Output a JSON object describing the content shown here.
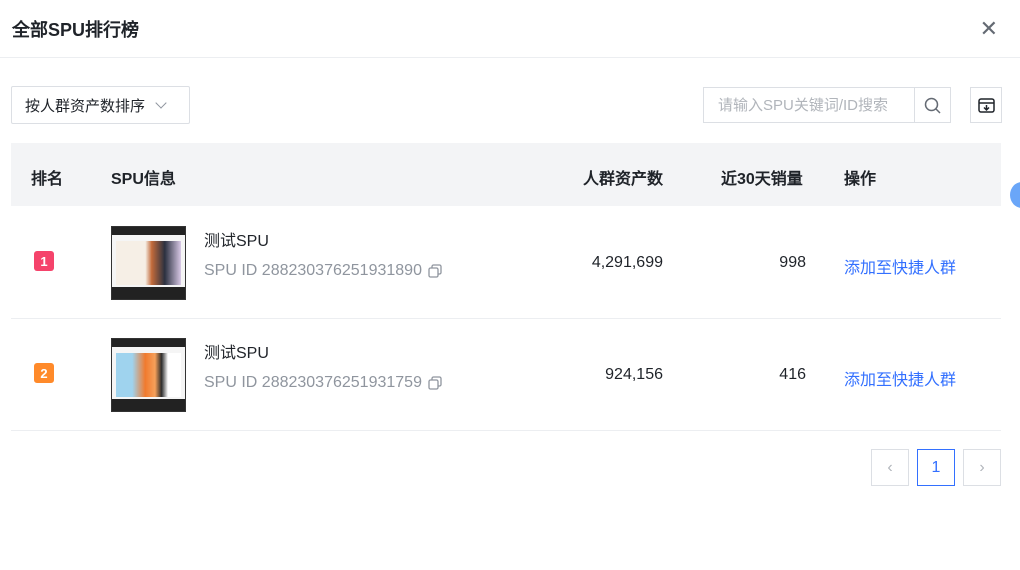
{
  "dialog": {
    "title": "全部SPU排行榜"
  },
  "toolbar": {
    "sort_label": "按人群资产数排序",
    "search_placeholder": "请输入SPU关键词/ID搜索",
    "search_value": ""
  },
  "table": {
    "headers": {
      "rank": "排名",
      "spu": "SPU信息",
      "assets": "人群资产数",
      "sales": "近30天销量",
      "action": "操作"
    },
    "rows": [
      {
        "rank": "1",
        "rank_color": "#f5436b",
        "name": "测试SPU",
        "id": "SPU ID 288230376251931890",
        "assets": "4,291,699",
        "sales": "998",
        "action": "添加至快捷人群"
      },
      {
        "rank": "2",
        "rank_color": "#ff8a2a",
        "name": "测试SPU",
        "id": "SPU ID 288230376251931759",
        "assets": "924,156",
        "sales": "416",
        "action": "添加至快捷人群"
      }
    ]
  },
  "pagination": {
    "current": "1"
  }
}
